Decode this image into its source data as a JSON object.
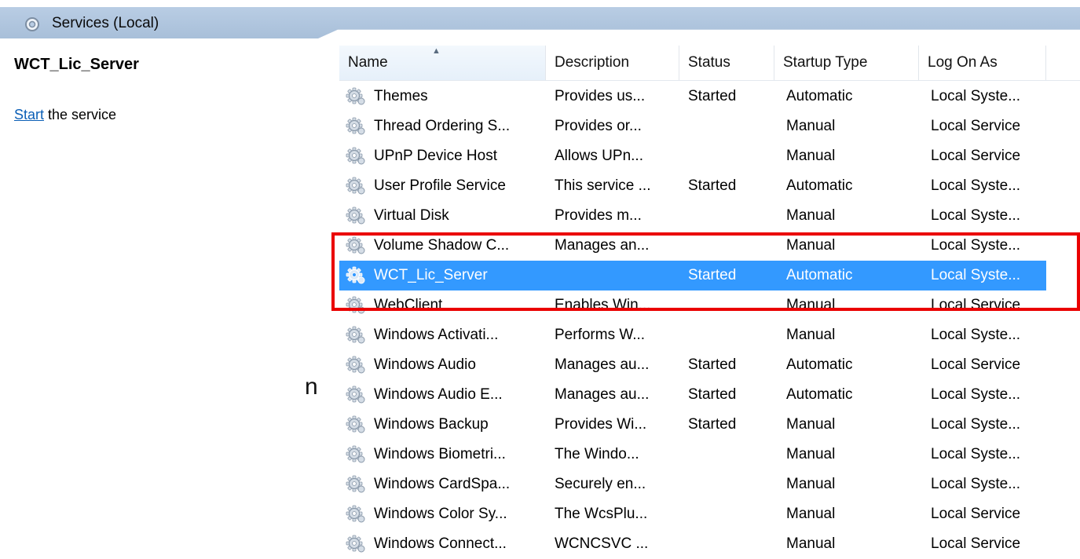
{
  "header": {
    "title": "Services (Local)",
    "icon": "services-gear-icon"
  },
  "detail": {
    "service_name": "WCT_Lic_Server",
    "action_link": "Start",
    "action_suffix": " the service",
    "edge_glyph": "n"
  },
  "table": {
    "columns": [
      "Name",
      "Description",
      "Status",
      "Startup Type",
      "Log On As"
    ],
    "sorted_column": "Name",
    "rows": [
      {
        "name": "Themes",
        "description": "Provides us...",
        "status": "Started",
        "startup": "Automatic",
        "logon": "Local Syste..."
      },
      {
        "name": "Thread Ordering S...",
        "description": "Provides or...",
        "status": "",
        "startup": "Manual",
        "logon": "Local Service"
      },
      {
        "name": "UPnP Device Host",
        "description": "Allows UPn...",
        "status": "",
        "startup": "Manual",
        "logon": "Local Service"
      },
      {
        "name": "User Profile Service",
        "description": "This service ...",
        "status": "Started",
        "startup": "Automatic",
        "logon": "Local Syste..."
      },
      {
        "name": "Virtual Disk",
        "description": "Provides m...",
        "status": "",
        "startup": "Manual",
        "logon": "Local Syste..."
      },
      {
        "name": "Volume Shadow C...",
        "description": "Manages an...",
        "status": "",
        "startup": "Manual",
        "logon": "Local Syste..."
      },
      {
        "name": "WCT_Lic_Server",
        "description": "",
        "status": "Started",
        "startup": "Automatic",
        "logon": "Local Syste...",
        "selected": true
      },
      {
        "name": "WebClient",
        "description": "Enables Win...",
        "status": "",
        "startup": "Manual",
        "logon": "Local Service"
      },
      {
        "name": "Windows Activati...",
        "description": "Performs W...",
        "status": "",
        "startup": "Manual",
        "logon": "Local Syste..."
      },
      {
        "name": "Windows Audio",
        "description": "Manages au...",
        "status": "Started",
        "startup": "Automatic",
        "logon": "Local Service"
      },
      {
        "name": "Windows Audio E...",
        "description": "Manages au...",
        "status": "Started",
        "startup": "Automatic",
        "logon": "Local Syste..."
      },
      {
        "name": "Windows Backup",
        "description": "Provides Wi...",
        "status": "Started",
        "startup": "Manual",
        "logon": "Local Syste..."
      },
      {
        "name": "Windows Biometri...",
        "description": "The Windo...",
        "status": "",
        "startup": "Manual",
        "logon": "Local Syste..."
      },
      {
        "name": "Windows CardSpa...",
        "description": "Securely en...",
        "status": "",
        "startup": "Manual",
        "logon": "Local Syste..."
      },
      {
        "name": "Windows Color Sy...",
        "description": "The WcsPlu...",
        "status": "",
        "startup": "Manual",
        "logon": "Local Service"
      },
      {
        "name": "Windows Connect...",
        "description": "WCNCSVC ...",
        "status": "",
        "startup": "Manual",
        "logon": "Local Service"
      }
    ]
  },
  "colors": {
    "selection": "#3399ff",
    "highlight_border": "#ea0000",
    "link": "#0b5fb6",
    "header_bar": "#b9cde4"
  }
}
